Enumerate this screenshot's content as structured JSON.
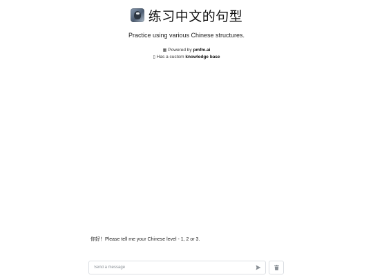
{
  "header": {
    "app_icon": "chess-knight-avatar-icon",
    "title": "练习中文的句型",
    "subtitle": "Practice using various Chinese structures.",
    "powered_prefix": "Powered by",
    "powered_by": "pmfm.ai",
    "knowledge_prefix": "Has a custom",
    "knowledge_link": "knowledge base"
  },
  "chat": {
    "messages": [
      {
        "role": "assistant",
        "text": "你好！Please tell me your Chinese level - 1, 2 or 3."
      }
    ]
  },
  "composer": {
    "placeholder": "Send a message",
    "value": "",
    "send_icon": "send-icon",
    "clear_icon": "trash-icon"
  },
  "colors": {
    "text": "#1f2328",
    "border": "#dcdfe3",
    "icon": "#8a9096"
  }
}
